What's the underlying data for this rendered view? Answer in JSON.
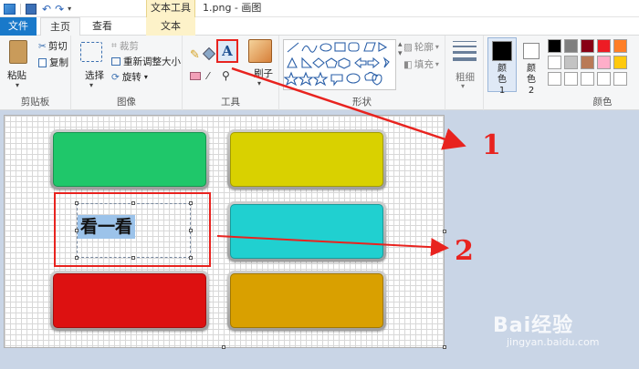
{
  "window": {
    "title": "1.png - 画图",
    "contextual_tab": "文本工具"
  },
  "tabs": [
    {
      "label": "文件"
    },
    {
      "label": "主页"
    },
    {
      "label": "查看"
    },
    {
      "label": "文本"
    }
  ],
  "clipboard": {
    "paste": "粘贴",
    "cut": "剪切",
    "copy": "复制",
    "group": "剪贴板"
  },
  "image": {
    "select": "选择",
    "crop": "裁剪",
    "resize": "重新调整大小",
    "rotate": "旋转",
    "group": "图像"
  },
  "tools": {
    "brushes": "刷子",
    "group": "工具"
  },
  "shapes": {
    "outline": "轮廓",
    "fill": "填充",
    "group": "形状"
  },
  "size": {
    "label": "粗细"
  },
  "colors": {
    "color1": "颜色1",
    "color2": "颜色2",
    "group": "颜色",
    "palette": [
      "#000000",
      "#7f7f7f",
      "#880015",
      "#ed1c24",
      "#ff7f27",
      "#ffffff",
      "#c3c3c3",
      "#b97a57",
      "#ffaec9",
      "#ffc90e",
      "#ffffff",
      "#ffffff",
      "#ffffff",
      "#ffffff",
      "#ffffff"
    ]
  },
  "canvas": {
    "selected_text": "看一看",
    "buttons": [
      {
        "color": "#1fc76a"
      },
      {
        "color": "#d9d100"
      },
      {
        "color": "#20d0d0"
      },
      {
        "color": "#dd1111"
      },
      {
        "color": "#d9a000"
      }
    ]
  },
  "annotations": {
    "label1": "1",
    "label2": "2",
    "arrow_color": "#e8231f"
  },
  "watermark": {
    "brand": "Bai经验",
    "url": "jingyan.baidu.com"
  }
}
